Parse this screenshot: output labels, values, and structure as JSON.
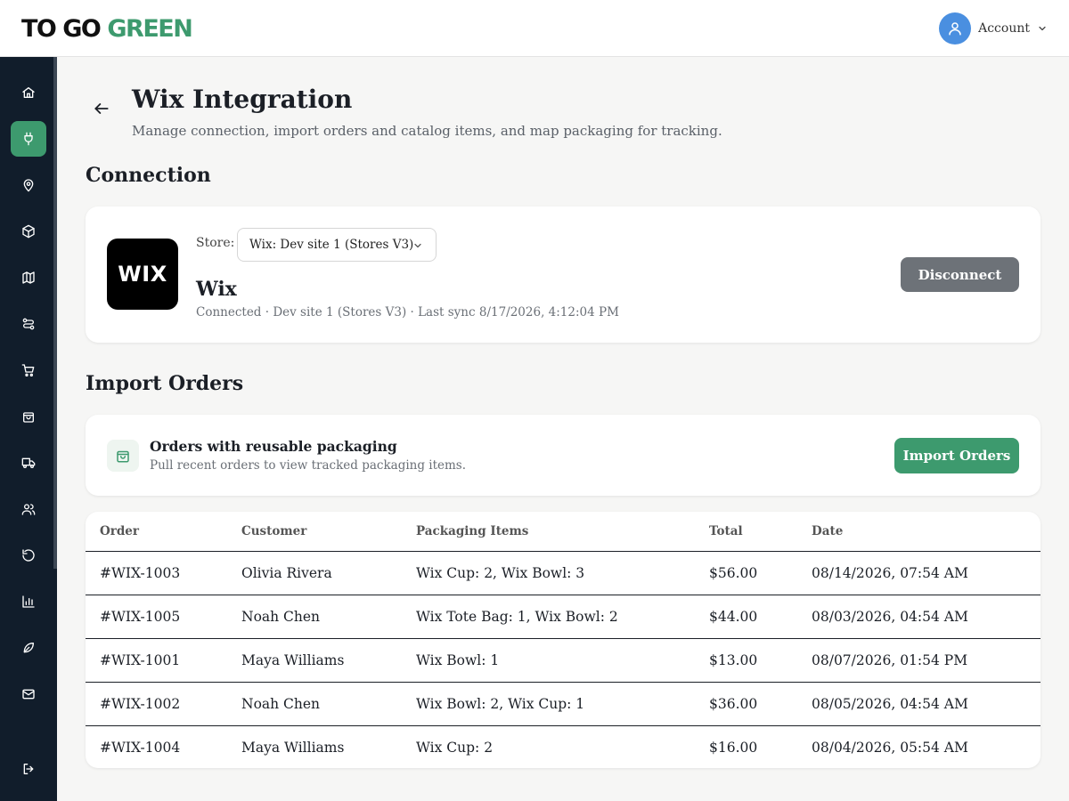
{
  "brand": {
    "part1": "TO GO",
    "part2": "GREEN",
    "accent": "#3d9a6e",
    "sidebar_bg": "#111d2b"
  },
  "account": {
    "label": "Account",
    "icon": "user-icon"
  },
  "sidebar": {
    "items": [
      {
        "name": "home",
        "icon": "home-icon",
        "active": false
      },
      {
        "name": "integrations",
        "icon": "plug-icon",
        "active": true
      },
      {
        "name": "locations",
        "icon": "map-pin-icon",
        "active": false
      },
      {
        "name": "products",
        "icon": "box-icon",
        "active": false
      },
      {
        "name": "map",
        "icon": "map-icon",
        "active": false
      },
      {
        "name": "routes",
        "icon": "route-icon",
        "active": false
      },
      {
        "name": "cart",
        "icon": "cart-icon",
        "active": false
      },
      {
        "name": "orders",
        "icon": "bag-icon",
        "active": false
      },
      {
        "name": "delivery",
        "icon": "truck-icon",
        "active": false
      },
      {
        "name": "users",
        "icon": "users-icon",
        "active": false
      },
      {
        "name": "returns",
        "icon": "rotate-icon",
        "active": false
      },
      {
        "name": "analytics",
        "icon": "bar-chart-icon",
        "active": false
      },
      {
        "name": "sustainability",
        "icon": "leaf-icon",
        "active": false
      },
      {
        "name": "mail",
        "icon": "mail-icon",
        "active": false
      }
    ],
    "logout_icon": "logout-icon"
  },
  "page": {
    "title": "Wix Integration",
    "subtitle": "Manage connection, import orders and catalog items, and map packaging for tracking."
  },
  "connection": {
    "section_title": "Connection",
    "logo_text": "WIX",
    "store_label": "Store:",
    "store_value": "Wix: Dev site 1 (Stores V3)",
    "provider_name": "Wix",
    "status": "Connected · Dev site 1 (Stores V3) · Last sync 8/17/2026, 4:12:04 PM",
    "disconnect_label": "Disconnect"
  },
  "import": {
    "section_title": "Import Orders",
    "card_title": "Orders with reusable packaging",
    "card_desc": "Pull recent orders to view tracked packaging items.",
    "button_label": "Import Orders"
  },
  "orders_table": {
    "headers": {
      "order": "Order",
      "customer": "Customer",
      "items": "Packaging Items",
      "total": "Total",
      "date": "Date"
    },
    "rows": [
      {
        "order": "#WIX-1003",
        "customer": "Olivia Rivera",
        "items": "Wix Cup: 2, Wix Bowl: 3",
        "total": "$56.00",
        "date": "08/14/2026, 07:54 AM"
      },
      {
        "order": "#WIX-1005",
        "customer": "Noah Chen",
        "items": "Wix Tote Bag: 1, Wix Bowl: 2",
        "total": "$44.00",
        "date": "08/03/2026, 04:54 AM"
      },
      {
        "order": "#WIX-1001",
        "customer": "Maya Williams",
        "items": "Wix Bowl: 1",
        "total": "$13.00",
        "date": "08/07/2026, 01:54 PM"
      },
      {
        "order": "#WIX-1002",
        "customer": "Noah Chen",
        "items": "Wix Bowl: 2, Wix Cup: 1",
        "total": "$36.00",
        "date": "08/05/2026, 04:54 AM"
      },
      {
        "order": "#WIX-1004",
        "customer": "Maya Williams",
        "items": "Wix Cup: 2",
        "total": "$16.00",
        "date": "08/04/2026, 05:54 AM"
      }
    ]
  }
}
